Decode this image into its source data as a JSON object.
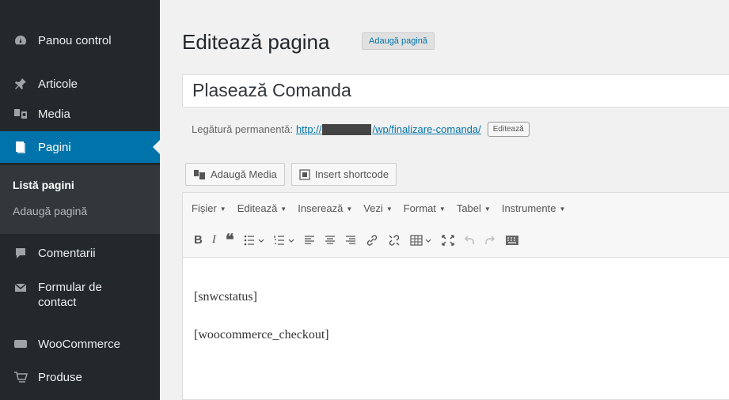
{
  "sidebar": {
    "items": [
      {
        "label": "Panou control",
        "icon": "dashboard-icon"
      },
      {
        "label": "Articole",
        "icon": "pin-icon"
      },
      {
        "label": "Media",
        "icon": "media-icon"
      },
      {
        "label": "Pagini",
        "icon": "pages-icon",
        "active": true
      },
      {
        "label": "Comentarii",
        "icon": "comment-icon"
      },
      {
        "label": "Formular de",
        "label2": "contact",
        "icon": "mail-icon"
      },
      {
        "label": "WooCommerce",
        "icon": "woo-icon"
      },
      {
        "label": "Produse",
        "icon": "cart-icon"
      }
    ],
    "submenu": [
      {
        "label": "Listă pagini",
        "current": true
      },
      {
        "label": "Adaugă pagină"
      }
    ]
  },
  "header": {
    "title": "Editează pagina",
    "add_new": "Adaugă pagină"
  },
  "editor": {
    "post_title": "Plasează Comanda",
    "permalink_label": "Legătură permanentă:",
    "permalink_prefix": "http://",
    "permalink_suffix": "/wp/finalizare-comanda/",
    "edit_button": "Editează",
    "add_media": "Adaugă Media",
    "insert_shortcode": "Insert shortcode",
    "menus": [
      "Fișier",
      "Editează",
      "Inserează",
      "Vezi",
      "Format",
      "Tabel",
      "Instrumente"
    ],
    "content": [
      "[snwcstatus]",
      "[woocommerce_checkout]"
    ]
  },
  "colors": {
    "sidebar_bg": "#23282d",
    "submenu_bg": "#32373c",
    "accent": "#0073aa"
  }
}
